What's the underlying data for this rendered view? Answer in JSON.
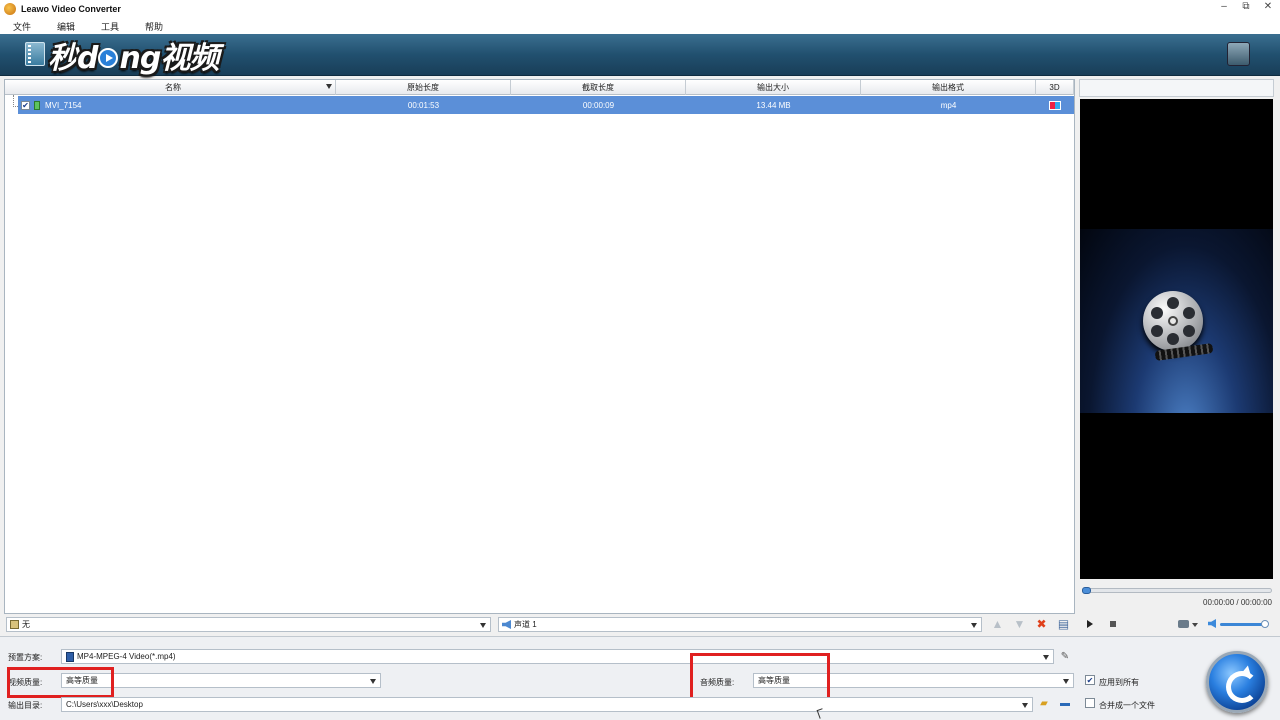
{
  "window": {
    "title": "Leawo Video Converter",
    "controls": [
      "–",
      "⧉",
      "✕"
    ]
  },
  "menu": [
    "文件",
    "编辑",
    "工具",
    "帮助"
  ],
  "banner": {
    "logo_text_1": "秒",
    "logo_text_2": "d",
    "logo_text_3": "ng",
    "logo_text_4": "视频"
  },
  "table": {
    "columns": [
      "名称",
      "原始长度",
      "截取长度",
      "输出大小",
      "输出格式",
      "3D"
    ],
    "rows": [
      {
        "checked": true,
        "name": "MVI_7154",
        "original_length": "00:01:53",
        "clip_length": "00:00:09",
        "output_size": "13.44 MB",
        "output_format": "mp4"
      }
    ]
  },
  "list_bottom": {
    "subtitle_value": "无",
    "audio_track_value": "声道 1"
  },
  "preview": {
    "time": "00:00:00 / 00:00:00",
    "progress_fraction": 0.0,
    "volume_fraction": 1.0
  },
  "settings": {
    "preset_label": "预置方案:",
    "preset_value": "MP4-MPEG-4 Video(*.mp4)",
    "video_quality_label": "视频质量:",
    "video_quality_value": "高等质量",
    "audio_quality_label": "音频质量:",
    "audio_quality_value": "高等质量",
    "output_dir_label": "输出目录:",
    "output_dir_value": "C:\\Users\\xxx\\Desktop",
    "apply_all_label": "应用到所有",
    "apply_all_checked": true,
    "merge_label": "合并成一个文件",
    "merge_checked": false
  },
  "colors": {
    "selection": "#5b8fd8",
    "highlight_box": "#e02020",
    "banner": "#21506f"
  }
}
